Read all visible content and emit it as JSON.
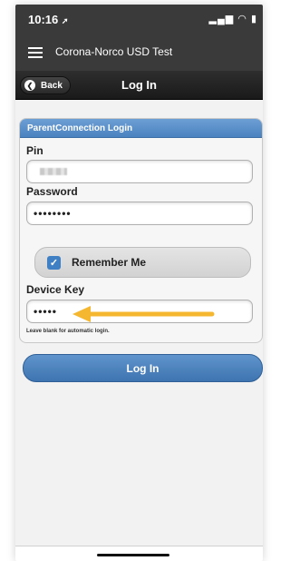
{
  "status_bar": {
    "time": "10:16",
    "location_icon": "location-arrow-icon",
    "icons": [
      "signal-icon",
      "wifi-icon",
      "battery-icon"
    ]
  },
  "app_bar": {
    "menu_icon": "hamburger-icon",
    "title": "Corona-Norco USD Test"
  },
  "header": {
    "back_label": "Back",
    "title": "Log In"
  },
  "login_form": {
    "panel_title": "ParentConnection Login",
    "pin_label": "Pin",
    "pin_value": "",
    "password_label": "Password",
    "password_value": "••••••••",
    "remember_label": "Remember Me",
    "remember_checked": true,
    "device_key_label": "Device Key",
    "device_key_value": "•••••",
    "device_key_hint": "Leave blank for automatic login."
  },
  "submit": {
    "label": "Log In"
  },
  "colors": {
    "panel_header": "#5a8fca",
    "button": "#4a80bd",
    "annotation_arrow": "#f5b730",
    "dark_bar": "#3a3a3a"
  }
}
